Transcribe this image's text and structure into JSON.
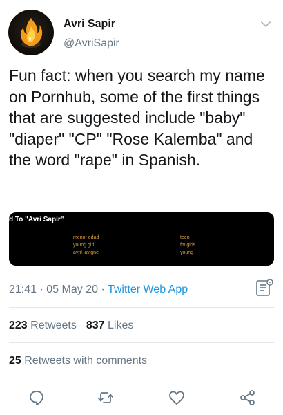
{
  "header": {
    "display_name": "Avri Sapir",
    "handle": "@AvriSapir",
    "avatar_icon": "fire-avatar",
    "menu_icon": "chevron-down-icon"
  },
  "tweet": {
    "text": "Fun fact: when you search my name on Pornhub, some of the first things that are suggested include \"baby\" \"diaper\" \"CP\" \"Rose Kalemba\" and the word \"rape\" in Spanish."
  },
  "media": {
    "title": "d To \"Avri Sapir\"",
    "suggestions_left": [
      "menor edad",
      "young girl",
      "avril lavigne"
    ],
    "suggestions_right": [
      "teen",
      "ftv girls",
      "young"
    ]
  },
  "meta": {
    "time": "21:41",
    "date": "05 May 20",
    "separator": "·",
    "source": "Twitter Web App"
  },
  "stats": {
    "retweets_count": "223",
    "retweets_label": "Retweets",
    "likes_count": "837",
    "likes_label": "Likes",
    "comments_count": "25",
    "comments_label": "Retweets with comments"
  },
  "colors": {
    "text": "#14171a",
    "secondary": "#657786",
    "link": "#1b95e0",
    "divider": "#e1e8ed"
  }
}
